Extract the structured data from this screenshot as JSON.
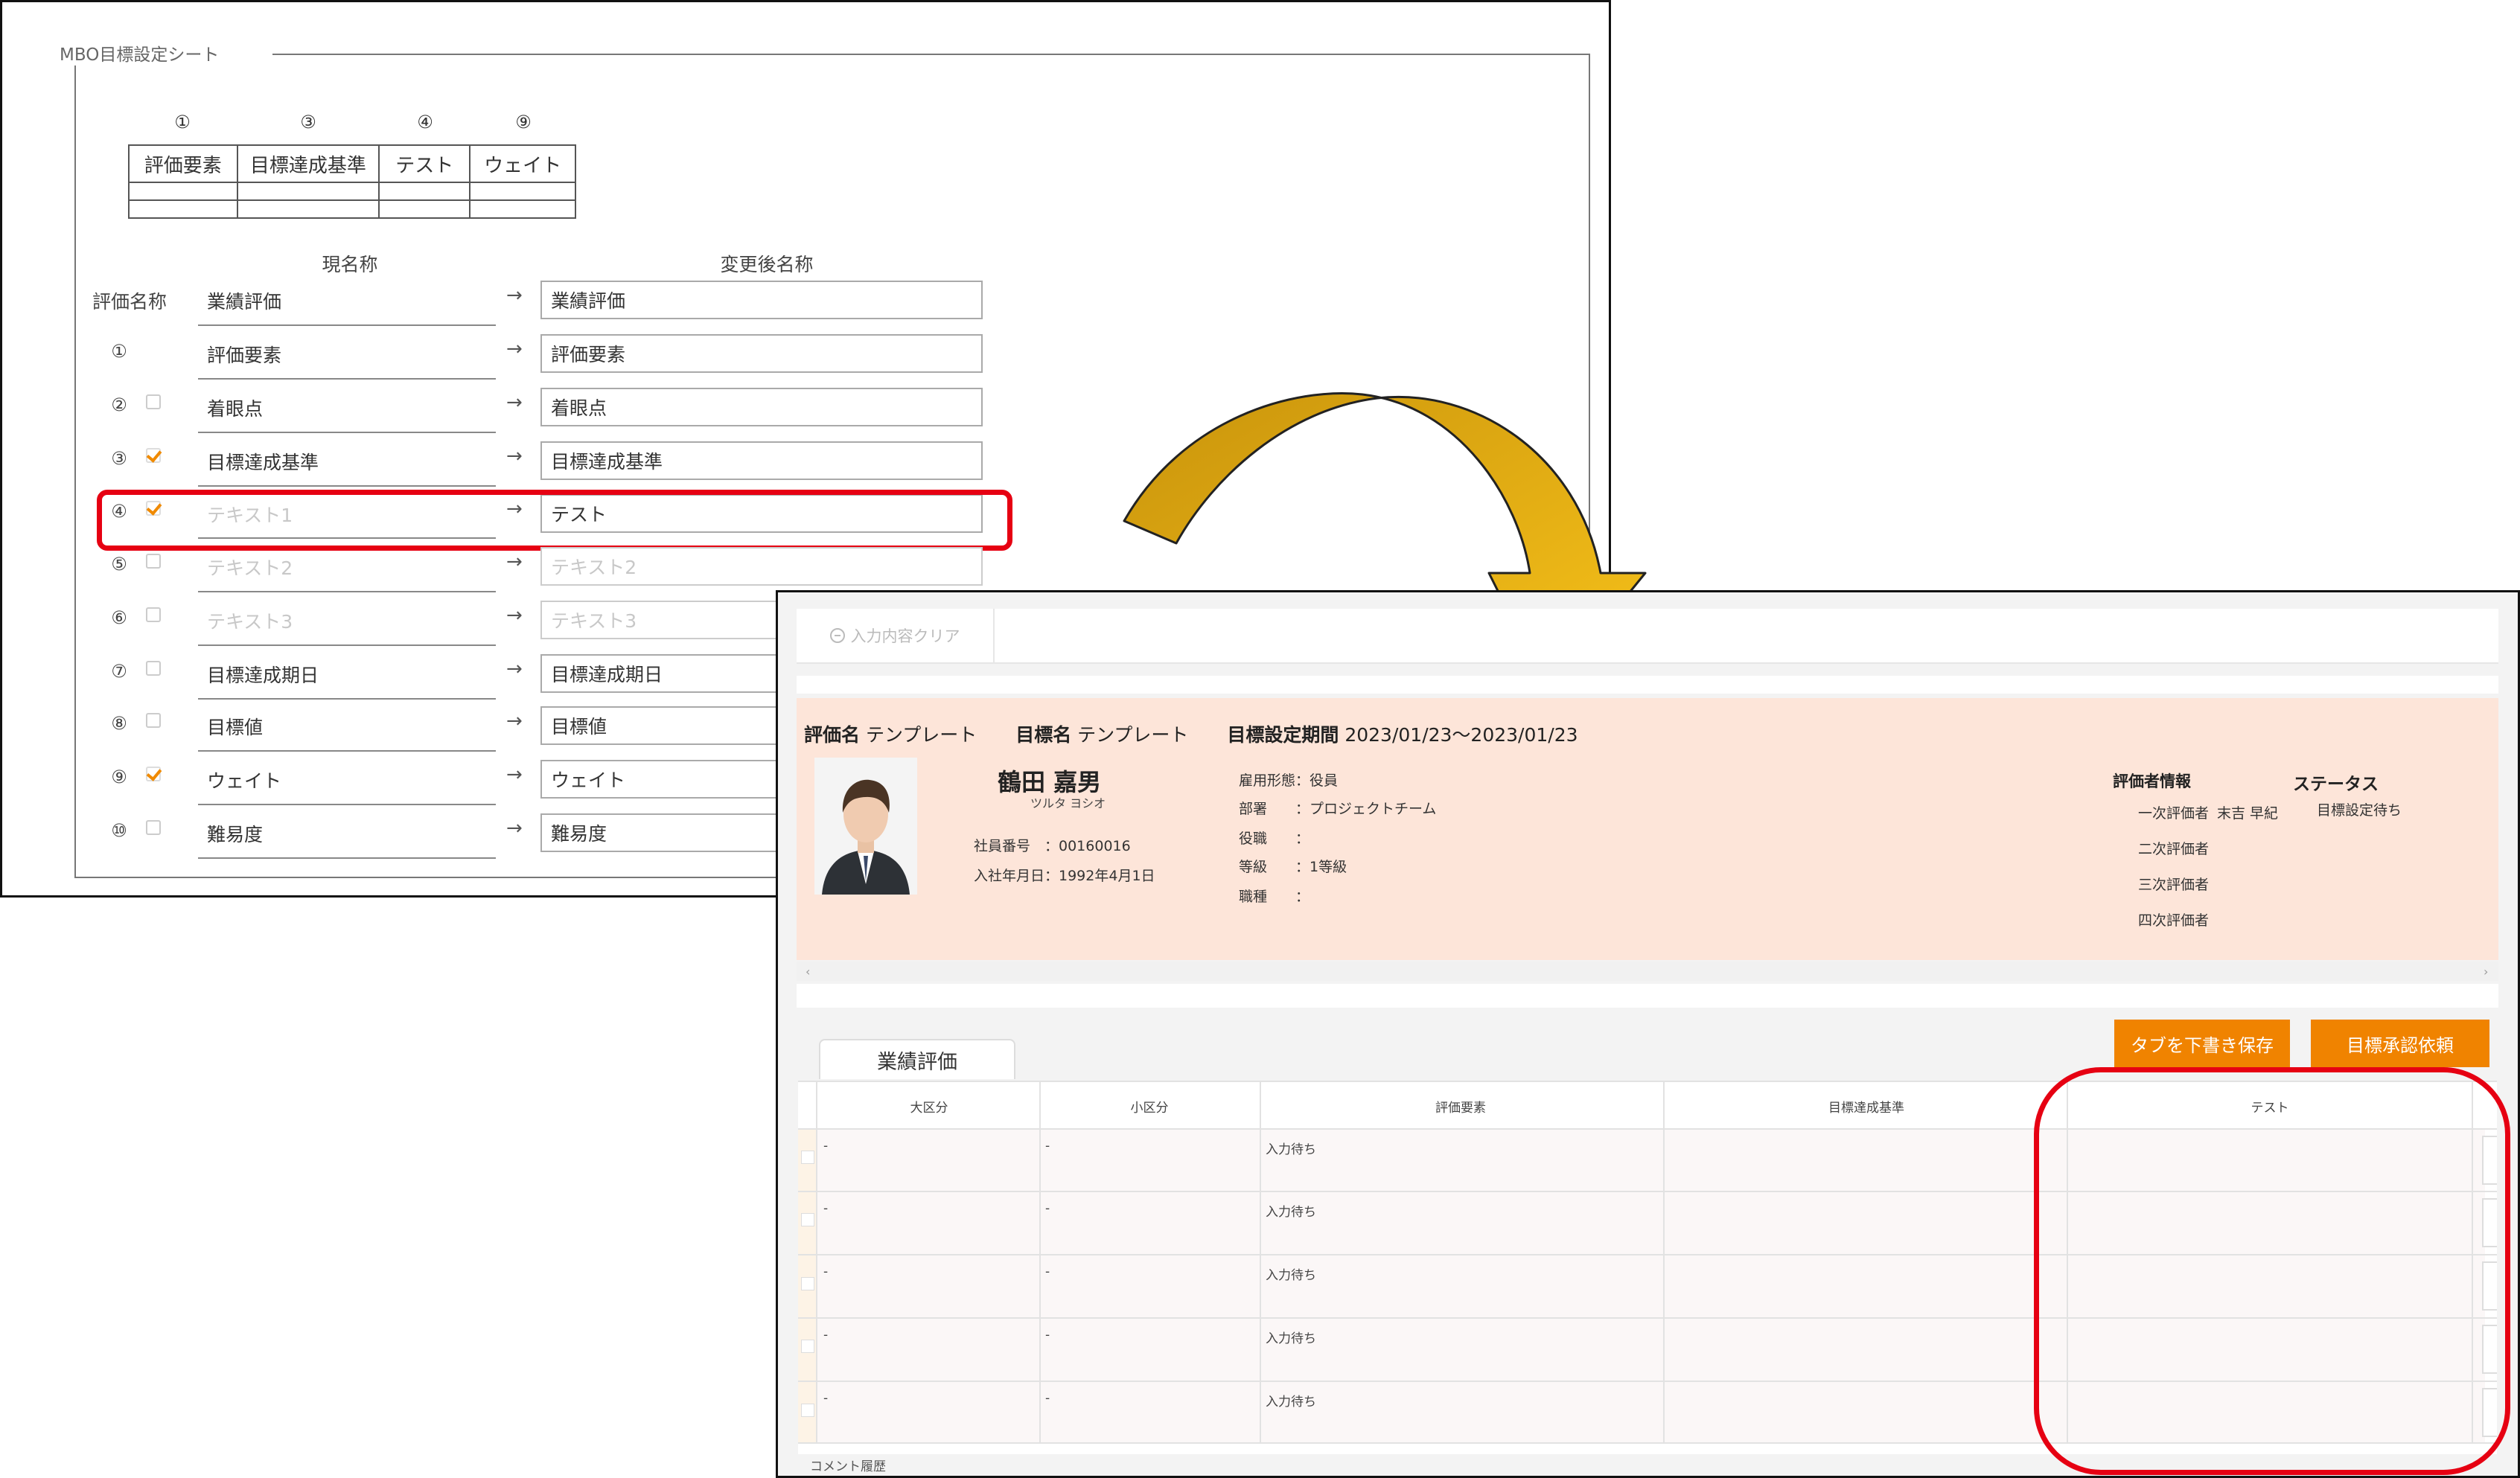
{
  "left": {
    "legend": "MBO目標設定シート",
    "mini_table": {
      "nums": [
        "①",
        "③",
        "④",
        "⑨"
      ],
      "headers": [
        "評価要素",
        "目標達成基準",
        "テスト",
        "ウェイト"
      ]
    },
    "col_current": "現名称",
    "col_changed": "変更後名称",
    "eval_name_label": "評価名称",
    "arrow": "→",
    "rows": [
      {
        "num": "",
        "current": "業績評価",
        "changed": "業績評価"
      },
      {
        "num": "①",
        "current": "評価要素",
        "changed": "評価要素"
      },
      {
        "num": "②",
        "current": "着眼点",
        "changed": "着眼点",
        "checked": false
      },
      {
        "num": "③",
        "current": "目標達成基準",
        "changed": "目標達成基準",
        "checked": true
      },
      {
        "num": "④",
        "current": "テキスト1",
        "changed": "テスト",
        "checked": true
      },
      {
        "num": "⑤",
        "current": "テキスト2",
        "changed": "テキスト2",
        "checked": false
      },
      {
        "num": "⑥",
        "current": "テキスト3",
        "changed": "テキスト3",
        "checked": false
      },
      {
        "num": "⑦",
        "current": "目標達成期日",
        "changed": "目標達成期日",
        "checked": false
      },
      {
        "num": "⑧",
        "current": "目標値",
        "changed": "目標値",
        "checked": false
      },
      {
        "num": "⑨",
        "current": "ウェイト",
        "changed": "ウェイト",
        "checked": true
      },
      {
        "num": "⑩",
        "current": "難易度",
        "changed": "難易度",
        "checked": false
      }
    ]
  },
  "right": {
    "clear_button": "入力内容クリア",
    "eval_name_label": "評価名",
    "eval_name_value": "テンプレート",
    "goal_name_label": "目標名",
    "goal_name_value": "テンプレート",
    "period_label": "目標設定期間",
    "period_value": "2023/01/23～2023/01/23",
    "employee_name": "鶴田 嘉男",
    "employee_kana": "ツルタ ヨシオ",
    "employee_no": "社員番号　：00160016",
    "hire_date": "入社年月日：1992年4月1日",
    "info": [
      "雇用形態：役員",
      "部署　　：プロジェクトチーム",
      "役職　　：",
      "等級　　：1等級",
      "職種　　："
    ],
    "evaluator_title": "評価者情報",
    "evaluators": [
      "一次評価者",
      "二次評価者",
      "三次評価者",
      "四次評価者"
    ],
    "first_evaluator_name": "末吉 早紀",
    "status_title": "ステータス",
    "status_value": "目標設定待ち",
    "save_draft_button": "タブを下書き保存",
    "approval_button": "目標承認依頼",
    "tab_label": "業績評価",
    "table_headers": [
      "大区分",
      "小区分",
      "評価要素",
      "目標達成基準",
      "テスト"
    ],
    "table_rows": [
      [
        "-",
        "-",
        "入力待ち"
      ],
      [
        "-",
        "-",
        "入力待ち"
      ],
      [
        "-",
        "-",
        "入力待ち"
      ],
      [
        "-",
        "-",
        "入力待ち"
      ],
      [
        "-",
        "-",
        "入力待ち"
      ]
    ],
    "comment_history": "コメント履歴"
  },
  "colors": {
    "accent_orange": "#f08300",
    "highlight_red": "#e60012",
    "arrow_gold": "#f2b400",
    "peach": "#fde5d9"
  }
}
